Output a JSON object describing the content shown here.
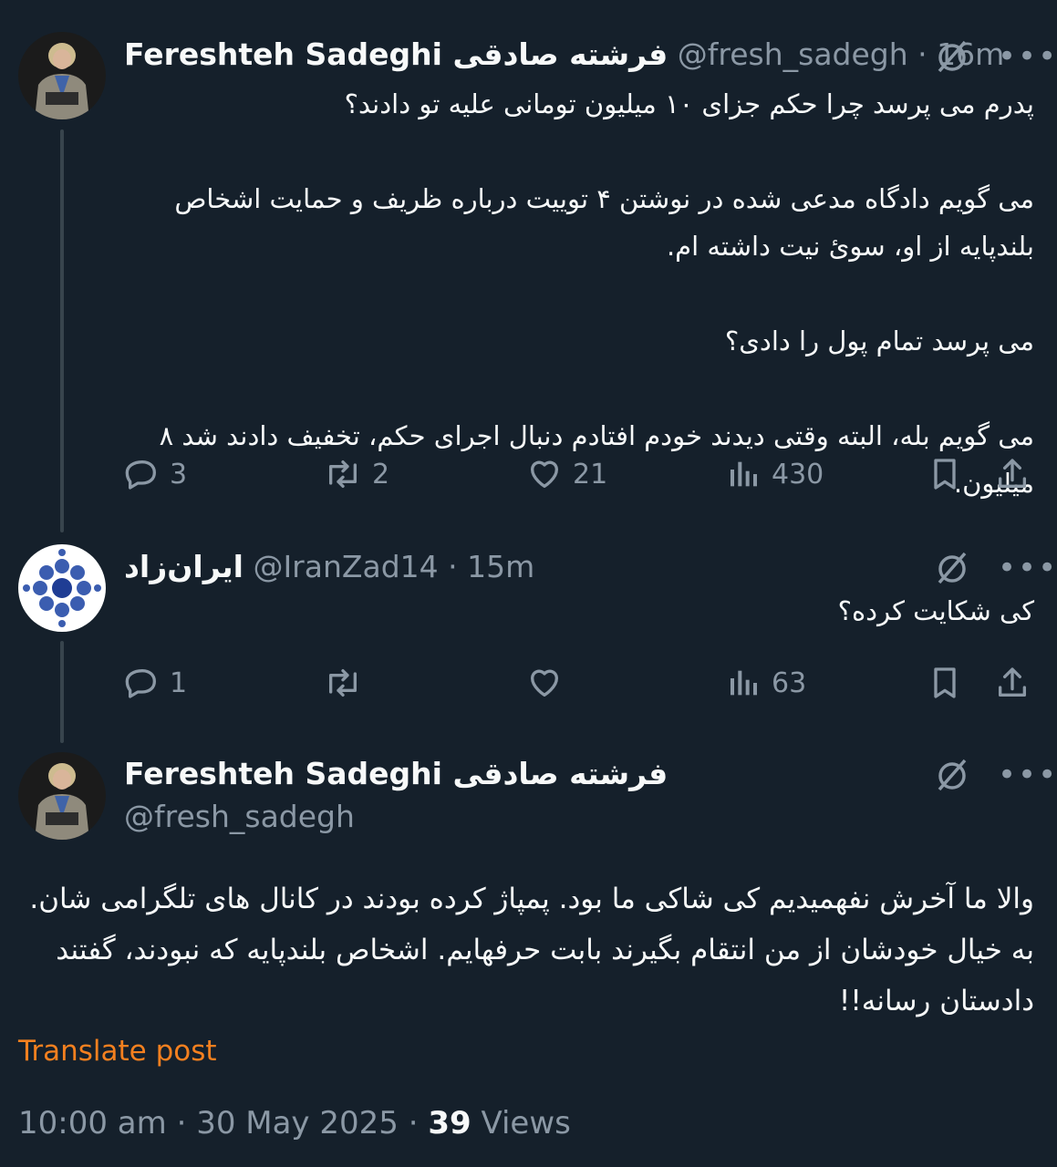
{
  "tweets": [
    {
      "name": "Fereshteh Sadeghi فرشته صادقی",
      "handle": "@fresh_sadegh",
      "time": "16m",
      "text": "پدرم می پرسد چرا حکم جزای ۱۰ میلیون تومانی علیه تو دادند؟\n\nمی گویم دادگاه مدعی شده در نوشتن ۴ توییت درباره ظریف و حمایت اشخاص بلندپایه از او، سوئ نیت داشته ام.\n\nمی پرسد تمام پول را دادی؟\n\nمی گویم بله، البته وقتی دیدند خودم افتادم دنبال اجرای حکم، تخفیف دادند شد ۸ میلیون.",
      "replies": "3",
      "reposts": "2",
      "likes": "21",
      "views": "430"
    },
    {
      "name": "ایران‌زاد",
      "handle": "@IranZad14",
      "time": "15m",
      "text": "کی شکایت کرده؟",
      "replies": "1",
      "reposts": "",
      "likes": "",
      "views": "63"
    }
  ],
  "main_tweet": {
    "name": "Fereshteh Sadeghi فرشته صادقی",
    "handle": "@fresh_sadegh",
    "text": "والا ما آخرش نفهمیدیم کی شاکی ما بود. پمپاژ کرده بودند در کانال های تلگرامی شان. به خیال خودشان از من انتقام بگیرند بابت حرفهایم. اشخاص بلندپایه که نبودند، گفتند دادستان رسانه!!",
    "translate_label": "Translate post",
    "time": "10:00 am",
    "date": "30 May 2025",
    "views_count": "39",
    "views_label": "Views"
  },
  "separator": "·",
  "colors": {
    "background": "#15202b",
    "text": "#f7f9f9",
    "secondary": "#8b98a5",
    "accent": "#f4801f",
    "thread_line": "#38444d"
  },
  "icons": [
    "grok-icon",
    "more-icon",
    "reply-icon",
    "repost-icon",
    "like-icon",
    "views-icon",
    "bookmark-icon",
    "share-icon"
  ]
}
